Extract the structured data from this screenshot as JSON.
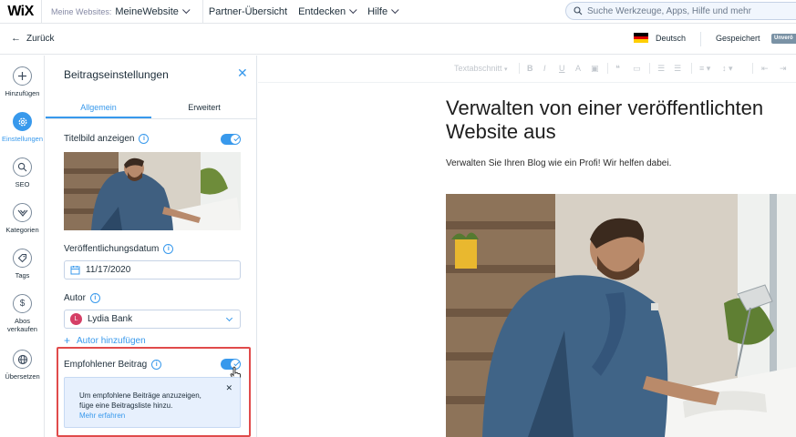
{
  "topbar": {
    "logo": "WiX",
    "site_prefix": "Meine Websites:",
    "site_name": "MeineWebsite",
    "nav": [
      "Partner-Übersicht",
      "Entdecken",
      "Hilfe"
    ],
    "search_placeholder": "Suche Werkzeuge, Apps, Hilfe und mehr"
  },
  "subbar": {
    "back": "Zurück",
    "language": "Deutsch",
    "saved": "Gespeichert",
    "badge": "Unverö"
  },
  "rail": {
    "items": [
      {
        "label": "Hinzufügen",
        "icon": "plus-icon"
      },
      {
        "label": "Einstellungen",
        "icon": "gear-icon",
        "active": true
      },
      {
        "label": "SEO",
        "icon": "search-icon"
      },
      {
        "label": "Kategorien",
        "icon": "categories-icon"
      },
      {
        "label": "Tags",
        "icon": "tag-icon"
      },
      {
        "label": "Abos verkaufen",
        "icon": "dollar-icon"
      },
      {
        "label": "Übersetzen",
        "icon": "globe-icon"
      }
    ]
  },
  "panel": {
    "title": "Beitragseinstellungen",
    "tabs": [
      "Allgemein",
      "Erweitert"
    ],
    "cover_label": "Titelbild anzeigen",
    "cover_enabled": true,
    "date_label": "Veröffentlichungsdatum",
    "date_value": "11/17/2020",
    "author_label": "Autor",
    "author_initial": "L",
    "author_name": "Lydia Bank",
    "add_author": "Autor hinzufügen",
    "featured_label": "Empfohlener Beitrag",
    "featured_enabled": true,
    "featured_hint_line1": "Um empfohlene Beiträge anzuzeigen,",
    "featured_hint_line2": "füge eine Beitragsliste hinzu.",
    "featured_more": "Mehr erfahren"
  },
  "editor": {
    "toolbar_style": "Textabschnitt",
    "title": "Verwalten von einer veröffentlichten Website aus",
    "subtitle": "Verwalten Sie Ihren Blog wie ein Profi! Wir helfen dabei."
  },
  "colors": {
    "accent": "#3899ec",
    "highlight": "#e04b4b",
    "author_avatar": "#d53f66"
  }
}
